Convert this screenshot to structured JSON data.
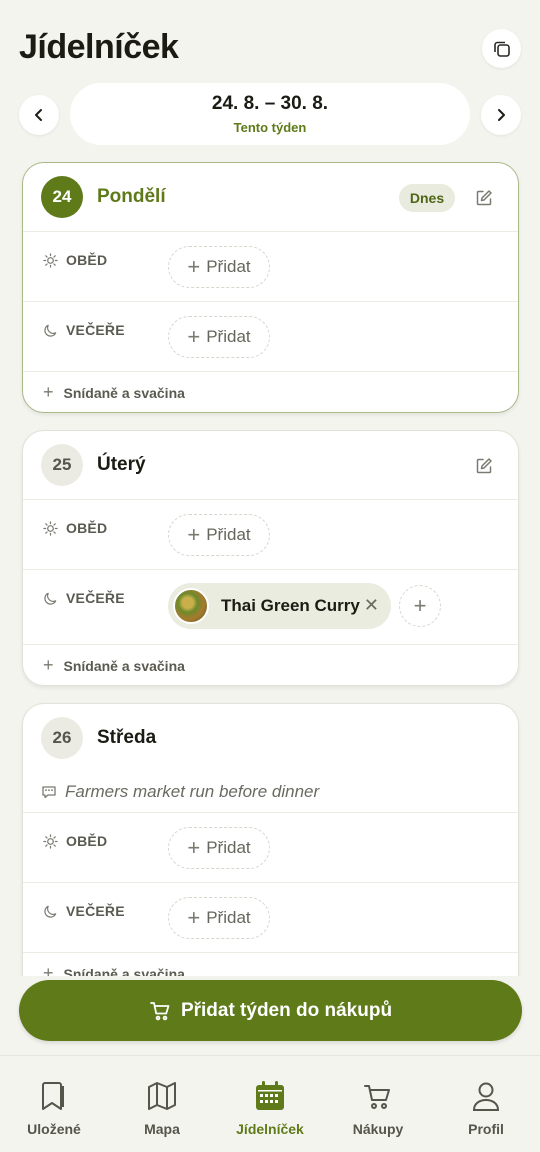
{
  "header": {
    "title": "Jídelníček",
    "copy_icon": "copy-icon"
  },
  "week": {
    "range": "24. 8. – 30. 8.",
    "subtitle": "Tento týden"
  },
  "days": [
    {
      "number": "24",
      "name": "Pondělí",
      "badge": "Dnes",
      "lunch_label": "OBĚD",
      "dinner_label": "VEČEŘE",
      "lunch_add": "Přidat",
      "dinner_add": "Přidat",
      "snack": "Snídaně a svačina"
    },
    {
      "number": "25",
      "name": "Úterý",
      "lunch_label": "OBĚD",
      "dinner_label": "VEČEŘE",
      "lunch_add": "Přidat",
      "dinner_recipe": "Thai Green Curry",
      "snack": "Snídaně a svačina"
    },
    {
      "number": "26",
      "name": "Středa",
      "note": "Farmers market run before dinner",
      "lunch_label": "OBĚD",
      "dinner_label": "VEČEŘE",
      "lunch_add": "Přidat",
      "dinner_add": "Přidat",
      "snack": "Snídaně a svačina"
    }
  ],
  "cta": {
    "label": "Přidat týden do nákupů"
  },
  "nav": [
    {
      "label": "Uložené",
      "icon": "bookmark-icon"
    },
    {
      "label": "Mapa",
      "icon": "map-icon"
    },
    {
      "label": "Jídelníček",
      "icon": "calendar-icon",
      "active": true
    },
    {
      "label": "Nákupy",
      "icon": "cart-icon"
    },
    {
      "label": "Profil",
      "icon": "profile-icon"
    }
  ],
  "colors": {
    "accent": "#5e7a19",
    "background": "#f4f4ef",
    "card": "#ffffff"
  }
}
